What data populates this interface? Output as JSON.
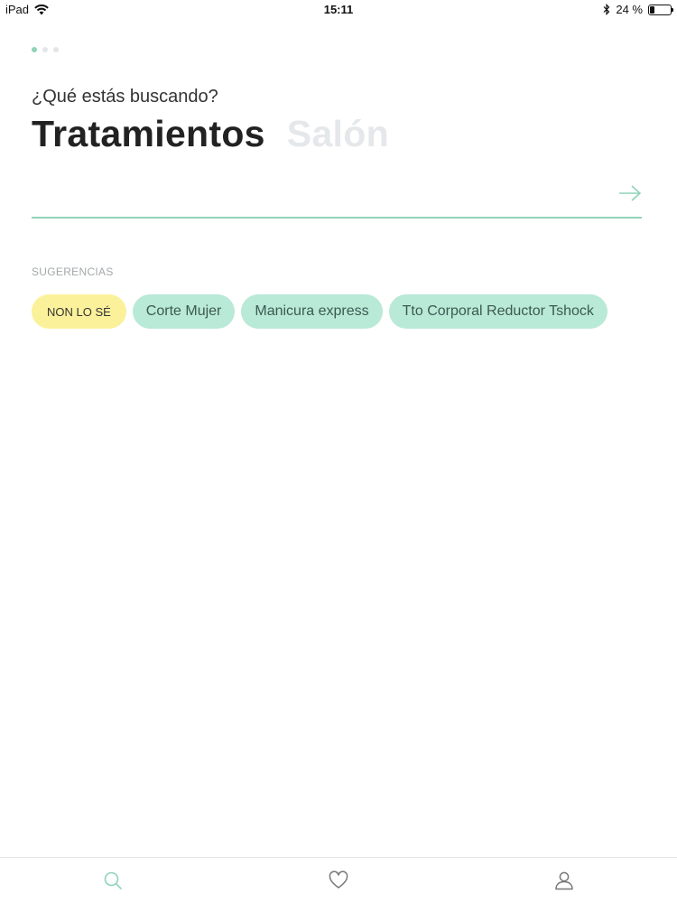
{
  "status_bar": {
    "device": "iPad",
    "time": "15:11",
    "battery_text": "24 %",
    "battery_level": 0.24,
    "icons": [
      "wifi-icon",
      "bluetooth-icon",
      "battery-icon"
    ]
  },
  "pager": {
    "count": 3,
    "active_index": 0
  },
  "search_prompt": "¿Qué estás buscando?",
  "mode_tabs": [
    {
      "label": "Tratamientos",
      "active": true
    },
    {
      "label": "Salón",
      "active": false
    }
  ],
  "search": {
    "value": "",
    "submit_icon": "arrow-right-icon"
  },
  "suggestions": {
    "label": "SUGERENCIAS",
    "chips": [
      {
        "label": "NON LO SÉ",
        "style": "primary"
      },
      {
        "label": "Corte Mujer",
        "style": "default"
      },
      {
        "label": "Manicura express",
        "style": "default"
      },
      {
        "label": "Tto Corporal Reductor Tshock",
        "style": "default"
      }
    ]
  },
  "bottom_tabs": [
    {
      "icon": "search-icon",
      "active": true
    },
    {
      "icon": "heart-icon",
      "active": false
    },
    {
      "icon": "user-icon",
      "active": false
    }
  ],
  "colors": {
    "accent": "#8fd3b8",
    "chip_default": "#b9e9d7",
    "chip_primary": "#fbf19b",
    "inactive_tab_text": "#e5e8ea"
  }
}
